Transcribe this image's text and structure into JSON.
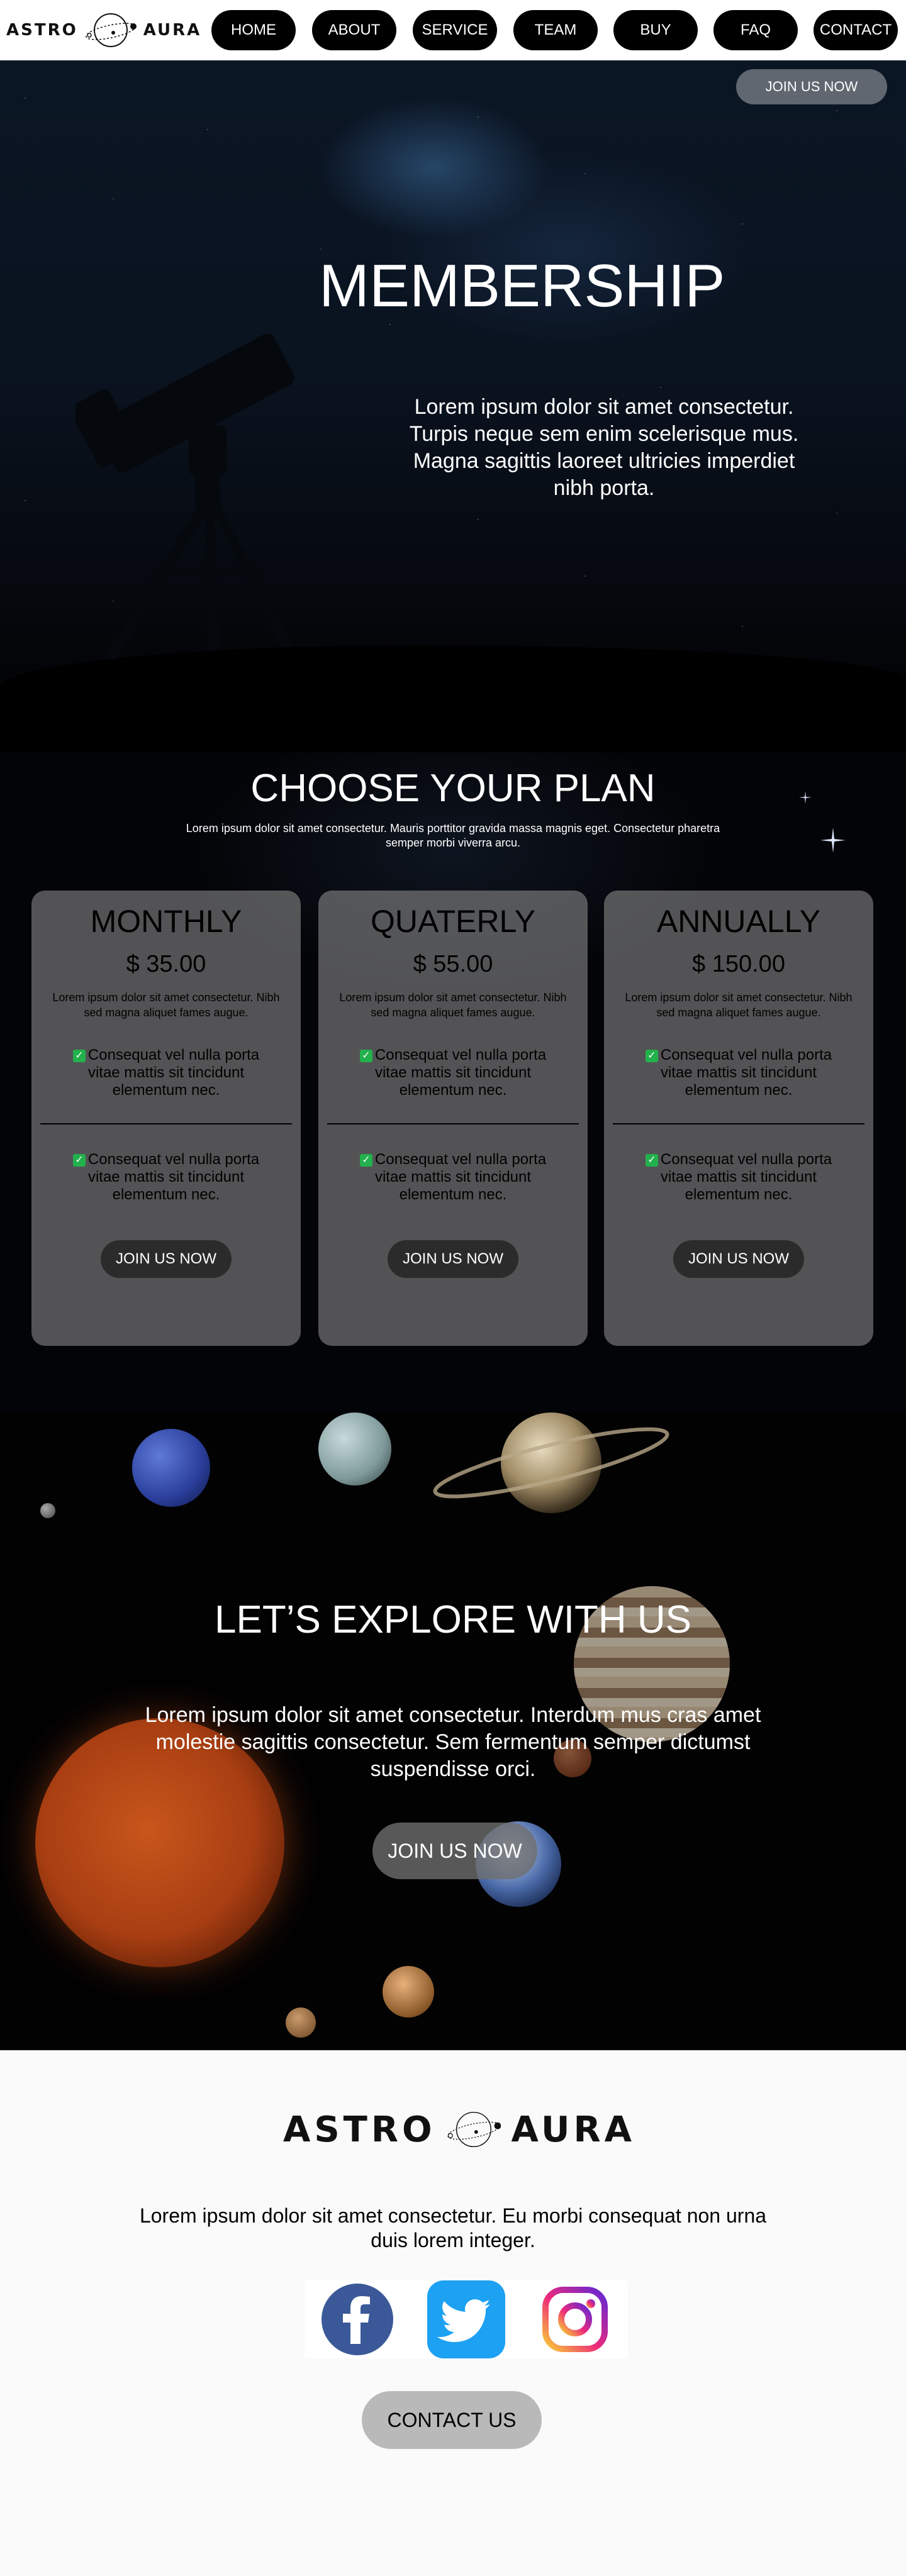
{
  "brand": {
    "left": "ASTRO",
    "right": "AURA"
  },
  "nav": {
    "items": [
      "HOME",
      "ABOUT",
      "SERVICE",
      "TEAM",
      "BUY",
      "FAQ",
      "CONTACT"
    ]
  },
  "hero": {
    "join_label": "JOIN US NOW",
    "title": "MEMBERSHIP",
    "text": "Lorem ipsum dolor sit amet consectetur. Turpis neque sem enim scelerisque mus. Magna sagittis laoreet ultricies imperdiet nibh porta."
  },
  "plans": {
    "title": "CHOOSE YOUR PLAN",
    "subtitle": "Lorem ipsum dolor sit amet consectetur. Mauris porttitor gravida massa magnis eget. Consectetur pharetra semper morbi viverra arcu.",
    "cards": [
      {
        "name": "MONTHLY",
        "price": "$ 35.00",
        "desc": "Lorem ipsum dolor sit amet consectetur. Nibh sed magna aliquet fames augue.",
        "feature1": "Consequat vel nulla porta vitae mattis sit tincidunt elementum nec.",
        "feature2": "Consequat vel nulla porta vitae mattis sit tincidunt elementum nec.",
        "button": "JOIN US NOW"
      },
      {
        "name": "QUATERLY",
        "price": "$ 55.00",
        "desc": "Lorem ipsum dolor sit amet consectetur. Nibh sed magna aliquet fames augue.",
        "feature1": "Consequat vel nulla porta vitae mattis sit tincidunt elementum nec.",
        "feature2": "Consequat vel nulla porta vitae mattis sit tincidunt elementum nec.",
        "button": "JOIN US NOW"
      },
      {
        "name": "ANNUALLY",
        "price": "$ 150.00",
        "desc": "Lorem ipsum dolor sit amet consectetur. Nibh sed magna aliquet fames augue.",
        "feature1": "Consequat vel nulla porta vitae mattis sit tincidunt elementum nec.",
        "feature2": "Consequat vel nulla porta vitae mattis sit tincidunt elementum nec.",
        "button": "JOIN US NOW"
      }
    ]
  },
  "explore": {
    "title": "LET’S EXPLORE WITH US",
    "text": "Lorem ipsum dolor sit amet consectetur. Interdum mus cras amet molestie sagittis consectetur. Sem fermentum semper dictumst suspendisse orci.",
    "button": "JOIN US NOW"
  },
  "footer": {
    "text": "Lorem ipsum dolor sit amet consectetur. Eu morbi consequat non urna duis lorem integer.",
    "contact_label": "CONTACT US",
    "socials": [
      "facebook-icon",
      "twitter-icon",
      "instagram-icon"
    ]
  },
  "colors": {
    "accent_check": "#22b14c",
    "card_bg": "#969696",
    "facebook": "#3b5998",
    "twitter": "#1da1f2"
  }
}
